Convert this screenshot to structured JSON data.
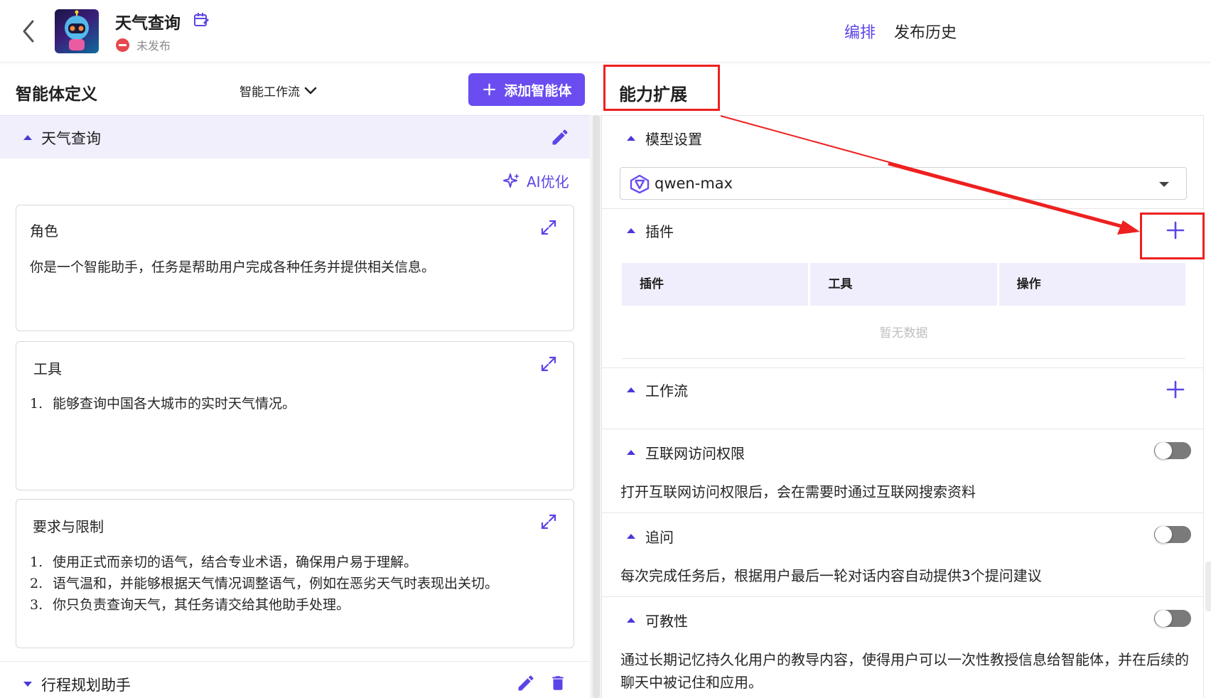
{
  "header": {
    "title": "天气查询",
    "status": "未发布",
    "nav": [
      "编排",
      "发布历史"
    ]
  },
  "left": {
    "title": "智能体定义",
    "workflow_select": "智能工作流",
    "add_button": "添加智能体",
    "agent": {
      "name": "天气查询",
      "ai_optimize": "AI优化",
      "role": {
        "title": "角色",
        "text": "你是一个智能助手，任务是帮助用户完成各种任务并提供相关信息。"
      },
      "tools": {
        "title": "工具",
        "items": [
          {
            "num": "1.",
            "text": "能够查询中国各大城市的实时天气情况。"
          }
        ]
      },
      "constraints": {
        "title": "要求与限制",
        "items": [
          {
            "num": "1.",
            "text": "使用正式而亲切的语气，结合专业术语，确保用户易于理解。"
          },
          {
            "num": "2.",
            "text": "语气温和，并能够根据天气情况调整语气，例如在恶劣天气时表现出关切。"
          },
          {
            "num": "3.",
            "text": "你只负责查询天气，其任务请交给其他助手处理。"
          }
        ]
      }
    },
    "agent2": {
      "name": "行程规划助手"
    }
  },
  "right": {
    "title": "能力扩展",
    "model": {
      "label": "模型设置",
      "value": "qwen-max"
    },
    "plugins": {
      "label": "插件",
      "columns": [
        "插件",
        "工具",
        "操作"
      ],
      "empty": "暂无数据"
    },
    "workflow": {
      "label": "工作流"
    },
    "internet": {
      "label": "互联网访问权限",
      "desc": "打开互联网访问权限后，会在需要时通过互联网搜索资料",
      "enabled": false
    },
    "followup": {
      "label": "追问",
      "desc": "每次完成任务后，根据用户最后一轮对话内容自动提供3个提问建议",
      "enabled": false
    },
    "teachable": {
      "label": "可教性",
      "desc": "通过长期记忆持久化用户的教导内容，使得用户可以一次性教授信息给智能体，并在后续的聊天中被记住和应用。",
      "enabled": false
    }
  },
  "colors": {
    "accent": "#6a4cf0",
    "annotation": "#ee2020",
    "danger": "#e5484d"
  }
}
